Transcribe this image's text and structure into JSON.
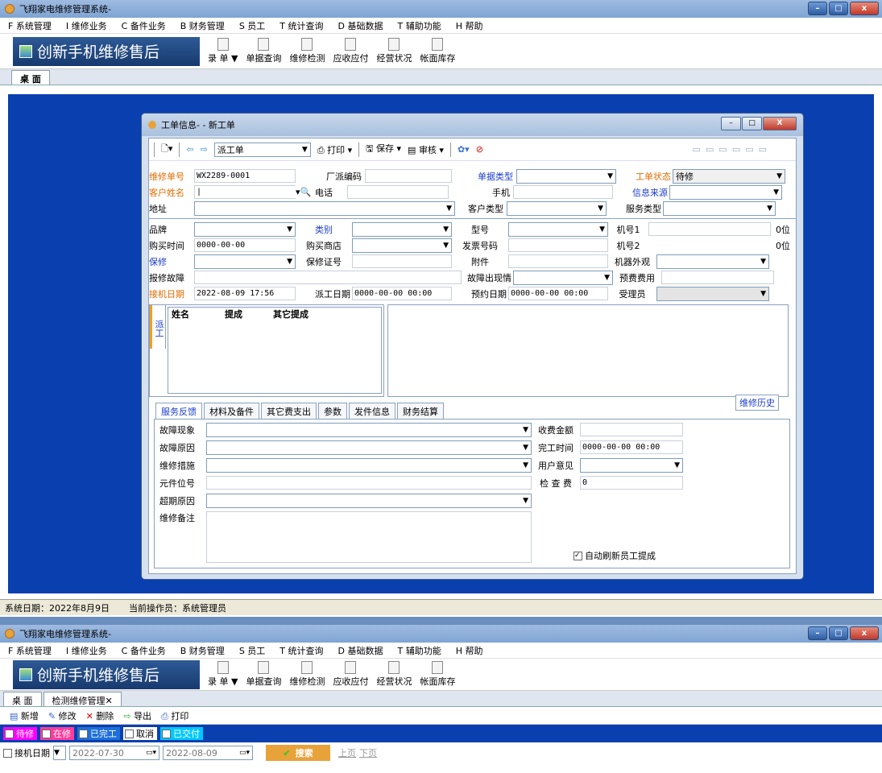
{
  "app": {
    "title": "飞翔家电维修管理系统-",
    "menus": [
      "F 系统管理",
      "I 维修业务",
      "C 备件业务",
      "B 财务管理",
      "S 员工",
      "T 统计查询",
      "D 基础数据",
      "T 辅助功能",
      "H 帮助"
    ],
    "brand": "创新手机维修售后",
    "toolbar": [
      "录 单 ▼",
      "单据查询",
      "维修检测",
      "应收应付",
      "经营状况",
      "帐面库存"
    ],
    "desk_tab": "桌 面",
    "status_date": "系统日期：2022年8月9日",
    "status_user": "当前操作员：系统管理员"
  },
  "dialog": {
    "title": "工单信息- - 新工单",
    "toolbar": {
      "dispatch": "派工单",
      "print": "打印",
      "save": "保存",
      "review": "审核"
    },
    "fields": {
      "repair_no_label": "维修单号",
      "repair_no": "WX2289-0001",
      "factory_code_label": "厂派编码",
      "doc_type_label": "单据类型",
      "order_status_label": "工单状态",
      "order_status": "待修",
      "customer_label": "客户姓名",
      "phone_label": "电话",
      "mobile_label": "手机",
      "info_source_label": "信息来源",
      "address_label": "地址",
      "customer_type_label": "客户类型",
      "service_type_label": "服务类型",
      "brand_label": "品牌",
      "category_label": "类别",
      "model_label": "型号",
      "serial1_label": "机号1",
      "serial1_suffix": "0位",
      "purchase_time_label": "购买时间",
      "purchase_time": "0000-00-00",
      "store_label": "购买商店",
      "invoice_label": "发票号码",
      "serial2_label": "机号2",
      "serial2_suffix": "0位",
      "warranty_label": "保修",
      "warranty_cert_label": "保修证号",
      "accessory_label": "附件",
      "appearance_label": "机器外观",
      "fault_label": "报修故障",
      "fault_occur_label": "故障出现情",
      "prepay_label": "预费费用",
      "receive_date_label": "接机日期",
      "receive_date": "2022-08-09 17:56",
      "dispatch_date_label": "派工日期",
      "dispatch_date": "0000-00-00 00:00",
      "appoint_date_label": "预约日期",
      "appoint_date": "0000-00-00 00:00",
      "handler_label": "受理员"
    },
    "dispatch_tab": "派工",
    "dispatch_cols": [
      "姓名",
      "提成",
      "其它提成"
    ],
    "history_btn": "维修历史",
    "bottom_tabs": [
      "服务反馈",
      "材料及备件",
      "其它费支出",
      "参数",
      "发件信息",
      "财务结算"
    ],
    "feedback": {
      "fault_phenomenon": "故障现象",
      "fault_reason": "故障原因",
      "measure": "维修措施",
      "component": "元件位号",
      "overdue": "超期原因",
      "note": "维修备注",
      "fee_label": "收费金额",
      "finish_label": "完工时间",
      "finish_time": "0000-00-00 00:00",
      "opinion_label": "用户意见",
      "check_fee_label": "检 查 费",
      "check_fee": "0",
      "auto_refresh": "自动刷新员工提成"
    }
  },
  "window2": {
    "tabs": [
      "桌 面",
      "检测维修管理"
    ],
    "actions": [
      "新增",
      "修改",
      "删除",
      "导出",
      "打印"
    ],
    "filters": [
      "待修",
      "在修",
      "已完工",
      "取消",
      "已交付"
    ],
    "date_field": "接机日期",
    "date_from": "2022-07-30",
    "date_to": "2022-08-09",
    "search": "搜索",
    "prev": "上页",
    "next": "下页"
  }
}
